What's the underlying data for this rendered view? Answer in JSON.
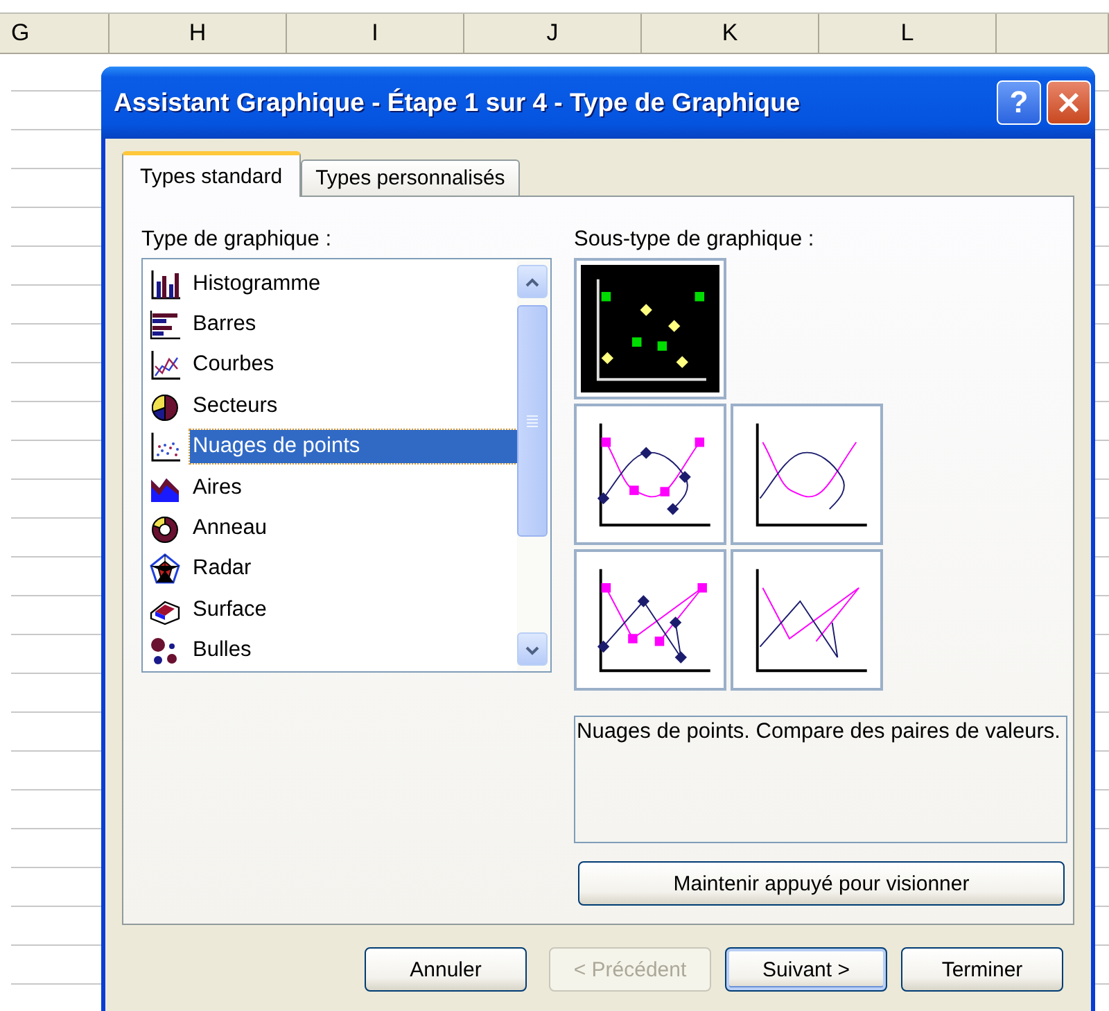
{
  "spreadsheet": {
    "columns": [
      "G",
      "H",
      "I",
      "J",
      "K",
      "L"
    ]
  },
  "window": {
    "title": "Assistant Graphique - Étape 1 sur 4 - Type de Graphique",
    "help_button": "?"
  },
  "tabs": [
    {
      "label": "Types standard",
      "selected": true
    },
    {
      "label": "Types personnalisés",
      "selected": false
    }
  ],
  "chart_types": {
    "label": "Type de graphique :",
    "items": [
      {
        "label": "Histogramme",
        "kind": "column",
        "selected": false
      },
      {
        "label": "Barres",
        "kind": "bar",
        "selected": false
      },
      {
        "label": "Courbes",
        "kind": "line",
        "selected": false
      },
      {
        "label": "Secteurs",
        "kind": "pie",
        "selected": false
      },
      {
        "label": "Nuages de points",
        "kind": "scatter",
        "selected": true
      },
      {
        "label": "Aires",
        "kind": "area",
        "selected": false
      },
      {
        "label": "Anneau",
        "kind": "doughnut",
        "selected": false
      },
      {
        "label": "Radar",
        "kind": "radar",
        "selected": false
      },
      {
        "label": "Surface",
        "kind": "surface",
        "selected": false
      },
      {
        "label": "Bulles",
        "kind": "bubble",
        "selected": false
      }
    ]
  },
  "subtypes": {
    "label": "Sous-type de graphique :",
    "items": [
      {
        "kind": "markers",
        "selected": true
      },
      {
        "kind": "smooth-markers",
        "selected": false
      },
      {
        "kind": "smooth",
        "selected": false
      },
      {
        "kind": "lines-markers",
        "selected": false
      },
      {
        "kind": "lines",
        "selected": false
      }
    ]
  },
  "description": "Nuages de points. Compare des paires de valeurs.",
  "preview_button": "Maintenir appuyé pour visionner",
  "buttons": [
    {
      "label": "Annuler",
      "disabled": false,
      "default": false
    },
    {
      "label": "< Précédent",
      "disabled": true,
      "default": false
    },
    {
      "label": "Suivant >",
      "disabled": false,
      "default": true
    },
    {
      "label": "Terminer",
      "disabled": false,
      "default": false
    }
  ]
}
